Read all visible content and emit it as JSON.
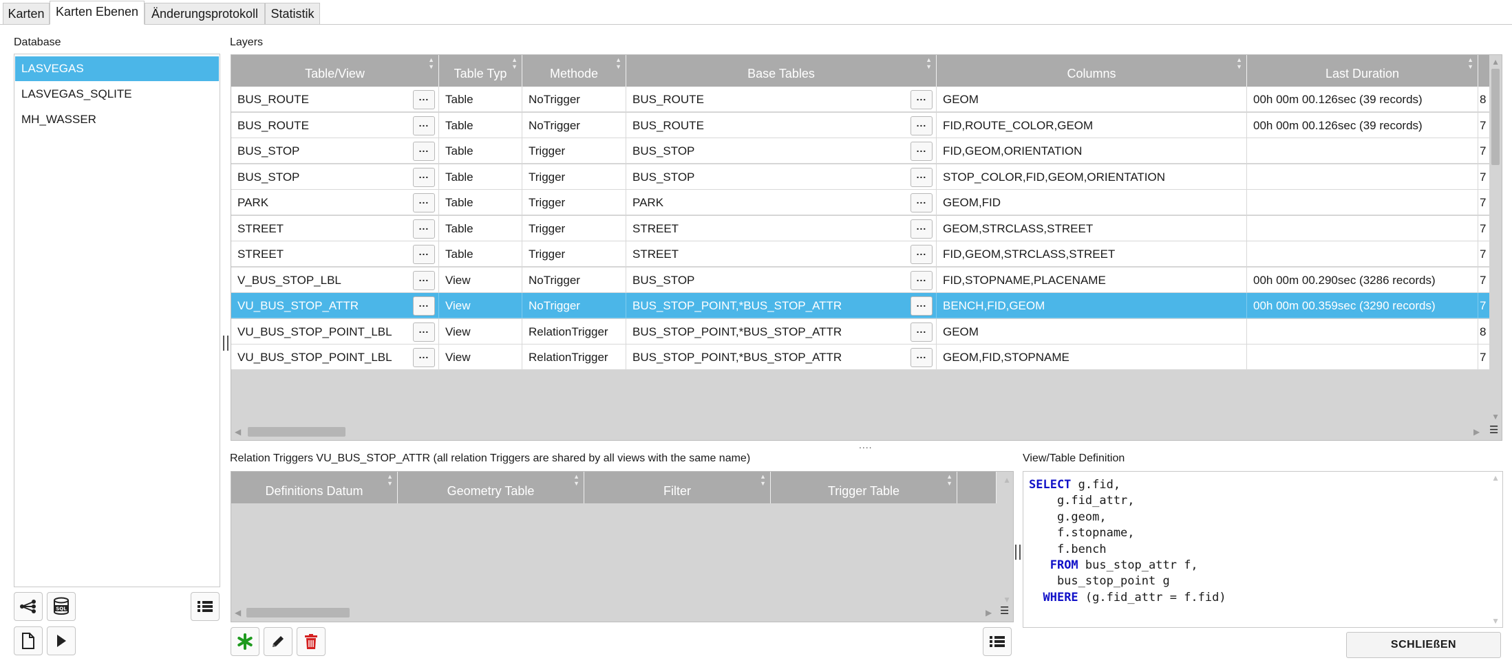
{
  "tabs": [
    {
      "label": "Karten"
    },
    {
      "label": "Karten Ebenen"
    },
    {
      "label": "Änderungsprotokoll"
    },
    {
      "label": "Statistik"
    }
  ],
  "database": {
    "label": "Database",
    "items": [
      "LASVEGAS",
      "LASVEGAS_SQLITE",
      "MH_WASSER"
    ],
    "selected": "LASVEGAS"
  },
  "layers": {
    "label": "Layers",
    "columns": [
      "Table/View",
      "Table Typ",
      "Methode",
      "Base Tables",
      "Columns",
      "Last Duration"
    ],
    "ellipsis": "...",
    "rows": [
      {
        "table": "BUS_ROUTE",
        "typ": "Table",
        "methode": "NoTrigger",
        "base": "BUS_ROUTE",
        "columns": "GEOM",
        "duration": "00h 00m 00.126sec (39 records)",
        "extra": "8"
      },
      {
        "table": "BUS_ROUTE",
        "typ": "Table",
        "methode": "NoTrigger",
        "base": "BUS_ROUTE",
        "columns": "FID,ROUTE_COLOR,GEOM",
        "duration": "00h 00m 00.126sec (39 records)",
        "extra": "7"
      },
      {
        "table": "BUS_STOP",
        "typ": "Table",
        "methode": "Trigger",
        "base": "BUS_STOP",
        "columns": "FID,GEOM,ORIENTATION",
        "duration": "",
        "extra": "7"
      },
      {
        "table": "BUS_STOP",
        "typ": "Table",
        "methode": "Trigger",
        "base": "BUS_STOP",
        "columns": "STOP_COLOR,FID,GEOM,ORIENTATION",
        "duration": "",
        "extra": "7"
      },
      {
        "table": "PARK",
        "typ": "Table",
        "methode": "Trigger",
        "base": "PARK",
        "columns": "GEOM,FID",
        "duration": "",
        "extra": "7"
      },
      {
        "table": "STREET",
        "typ": "Table",
        "methode": "Trigger",
        "base": "STREET",
        "columns": "GEOM,STRCLASS,STREET",
        "duration": "",
        "extra": "7"
      },
      {
        "table": "STREET",
        "typ": "Table",
        "methode": "Trigger",
        "base": "STREET",
        "columns": "FID,GEOM,STRCLASS,STREET",
        "duration": "",
        "extra": "7"
      },
      {
        "table": "V_BUS_STOP_LBL",
        "typ": "View",
        "methode": "NoTrigger",
        "base": "BUS_STOP",
        "columns": "FID,STOPNAME,PLACENAME",
        "duration": "00h 00m 00.290sec (3286 records)",
        "extra": "7"
      },
      {
        "table": "VU_BUS_STOP_ATTR",
        "typ": "View",
        "methode": "NoTrigger",
        "base": "BUS_STOP_POINT,*BUS_STOP_ATTR",
        "columns": "BENCH,FID,GEOM",
        "duration": "00h 00m 00.359sec (3290 records)",
        "extra": "7",
        "selected": true
      },
      {
        "table": "VU_BUS_STOP_POINT_LBL",
        "typ": "View",
        "methode": "RelationTrigger",
        "base": "BUS_STOP_POINT,*BUS_STOP_ATTR",
        "columns": "GEOM",
        "duration": "",
        "extra": "8"
      },
      {
        "table": "VU_BUS_STOP_POINT_LBL",
        "typ": "View",
        "methode": "RelationTrigger",
        "base": "BUS_STOP_POINT,*BUS_STOP_ATTR",
        "columns": "GEOM,FID,STOPNAME",
        "duration": "",
        "extra": "7"
      }
    ]
  },
  "relation": {
    "label": "Relation Triggers VU_BUS_STOP_ATTR (all relation Triggers are shared by all views with the same name)",
    "columns": [
      "Definitions Datum",
      "Geometry Table",
      "Filter",
      "Trigger Table"
    ]
  },
  "definition": {
    "label": "View/Table Definition",
    "lines": [
      [
        {
          "k": true,
          "t": "SELECT"
        },
        {
          "k": false,
          "t": " g.fid,"
        }
      ],
      [
        {
          "k": false,
          "t": "    g.fid_attr,"
        }
      ],
      [
        {
          "k": false,
          "t": "    g.geom,"
        }
      ],
      [
        {
          "k": false,
          "t": "    f.stopname,"
        }
      ],
      [
        {
          "k": false,
          "t": "    f.bench"
        }
      ],
      [
        {
          "k": false,
          "t": "   "
        },
        {
          "k": true,
          "t": "FROM"
        },
        {
          "k": false,
          "t": " bus_stop_attr f,"
        }
      ],
      [
        {
          "k": false,
          "t": "    bus_stop_point g"
        }
      ],
      [
        {
          "k": false,
          "t": "  "
        },
        {
          "k": true,
          "t": "WHERE"
        },
        {
          "k": false,
          "t": " (g.fid_attr = f.fid)"
        }
      ]
    ]
  },
  "close_label": "SCHLIEßEN",
  "colors": {
    "selection": "#4bb6e8",
    "header": "#ababab",
    "keyword": "#1010c8",
    "add": "#1e9a1e",
    "delete": "#d42020"
  }
}
